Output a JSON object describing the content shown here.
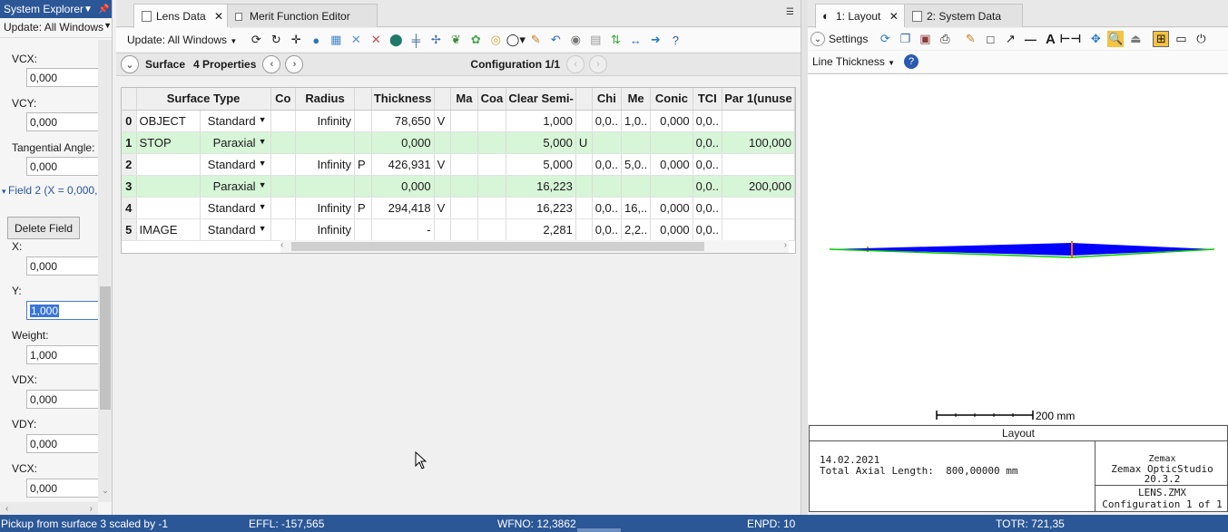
{
  "system_explorer": {
    "title": "System Explorer",
    "update_label": "Update: All Windows",
    "properties": [
      {
        "label": "VCX:",
        "value": "0,000"
      },
      {
        "label": "VCY:",
        "value": "0,000"
      },
      {
        "label": "Tangential Angle:",
        "value": "0,000"
      }
    ],
    "field_label": "Field 2 (X = 0,000,",
    "delete_button": "Delete Field",
    "field_props": [
      {
        "label": "X:",
        "value": "0,000"
      },
      {
        "label": "Y:",
        "value": "1,000",
        "selected": true
      },
      {
        "label": "Weight:",
        "value": "1,000"
      },
      {
        "label": "VDX:",
        "value": "0,000"
      },
      {
        "label": "VDY:",
        "value": "0,000"
      },
      {
        "label": "VCX:",
        "value": "0,000"
      }
    ]
  },
  "lens_editor": {
    "tabs": [
      {
        "label": "Lens Data",
        "active": true
      },
      {
        "label": "Merit Function Editor",
        "active": false
      }
    ],
    "update_label": "Update: All Windows",
    "surface_label": "Surface",
    "properties_label": "4 Properties",
    "configuration_label": "Configuration 1/1",
    "columns": [
      "Surface Type",
      "Co",
      "Radius",
      "",
      "Thickness",
      "",
      "Ma",
      "Coa",
      "Clear Semi-",
      "",
      "Chi",
      "Me",
      "Conic",
      "TCI",
      "Par 1(unuse"
    ],
    "rows": [
      {
        "num": "0",
        "name": "OBJECT",
        "type": "Standard",
        "co": "",
        "radius": "Infinity",
        "rs": "",
        "thickness": "78,650",
        "ts": "V",
        "ma": "",
        "coa": "",
        "semi": "1,000",
        "ss": "",
        "chi": "0,0..",
        "me": "1,0..",
        "conic": "0,000",
        "tce": "0,0..",
        "par1": "",
        "green": false
      },
      {
        "num": "1",
        "name": "STOP",
        "type": "Paraxial",
        "co": "",
        "radius": "",
        "rs": "",
        "thickness": "0,000",
        "ts": "",
        "ma": "",
        "coa": "",
        "semi": "5,000",
        "ss": "U",
        "chi": "",
        "me": "",
        "conic": "",
        "tce": "0,0..",
        "par1": "100,000",
        "green": true
      },
      {
        "num": "2",
        "name": "",
        "type": "Standard",
        "co": "",
        "radius": "Infinity",
        "rs": "P",
        "thickness": "426,931",
        "ts": "V",
        "ma": "",
        "coa": "",
        "semi": "5,000",
        "ss": "",
        "chi": "0,0..",
        "me": "5,0..",
        "conic": "0,000",
        "tce": "0,0..",
        "par1": "",
        "green": false
      },
      {
        "num": "3",
        "name": "",
        "type": "Paraxial",
        "co": "",
        "radius": "",
        "rs": "",
        "thickness": "0,000",
        "ts": "",
        "ma": "",
        "coa": "",
        "semi": "16,223",
        "ss": "",
        "chi": "",
        "me": "",
        "conic": "",
        "tce": "0,0..",
        "par1": "200,000",
        "green": true
      },
      {
        "num": "4",
        "name": "",
        "type": "Standard",
        "co": "",
        "radius": "Infinity",
        "rs": "P",
        "thickness": "294,418",
        "ts": "V",
        "ma": "",
        "coa": "",
        "semi": "16,223",
        "ss": "",
        "chi": "0,0..",
        "me": "16,..",
        "conic": "0,000",
        "tce": "0,0..",
        "par1": "",
        "green": false
      },
      {
        "num": "5",
        "name": "IMAGE",
        "type": "Standard",
        "co": "",
        "radius": "Infinity",
        "rs": "",
        "thickness": "-",
        "ts": "",
        "ma": "",
        "coa": "",
        "semi": "2,281",
        "ss": "",
        "chi": "0,0..",
        "me": "2,2..",
        "conic": "0,000",
        "tce": "0,0..",
        "par1": "",
        "green": false
      }
    ]
  },
  "layout_window": {
    "tabs": [
      {
        "label": "1: Layout",
        "active": true
      },
      {
        "label": "2: System Data",
        "active": false
      }
    ],
    "settings_label": "Settings",
    "line_thickness_label": "Line Thickness",
    "scale_label": "200 mm",
    "info": {
      "header": "Layout",
      "date": "14.02.2021",
      "axial_length": "Total Axial Length:  800,00000 mm",
      "vendor": "Zemax",
      "product": "Zemax OpticStudio 20.3.2",
      "file": "LENS.ZMX",
      "config": "Configuration 1 of 1"
    },
    "colors": {
      "ray_fill": "#0000ff",
      "ray_edge": "#00cc00",
      "stop": "#ff6600"
    }
  },
  "status_bar": {
    "message": "Pickup from surface 3 scaled by -1",
    "effl": "EFFL: -157,565",
    "wfno": "WFNO: 12,3862",
    "enpd": "ENPD: 10",
    "totr": "TOTR: 721,35"
  }
}
